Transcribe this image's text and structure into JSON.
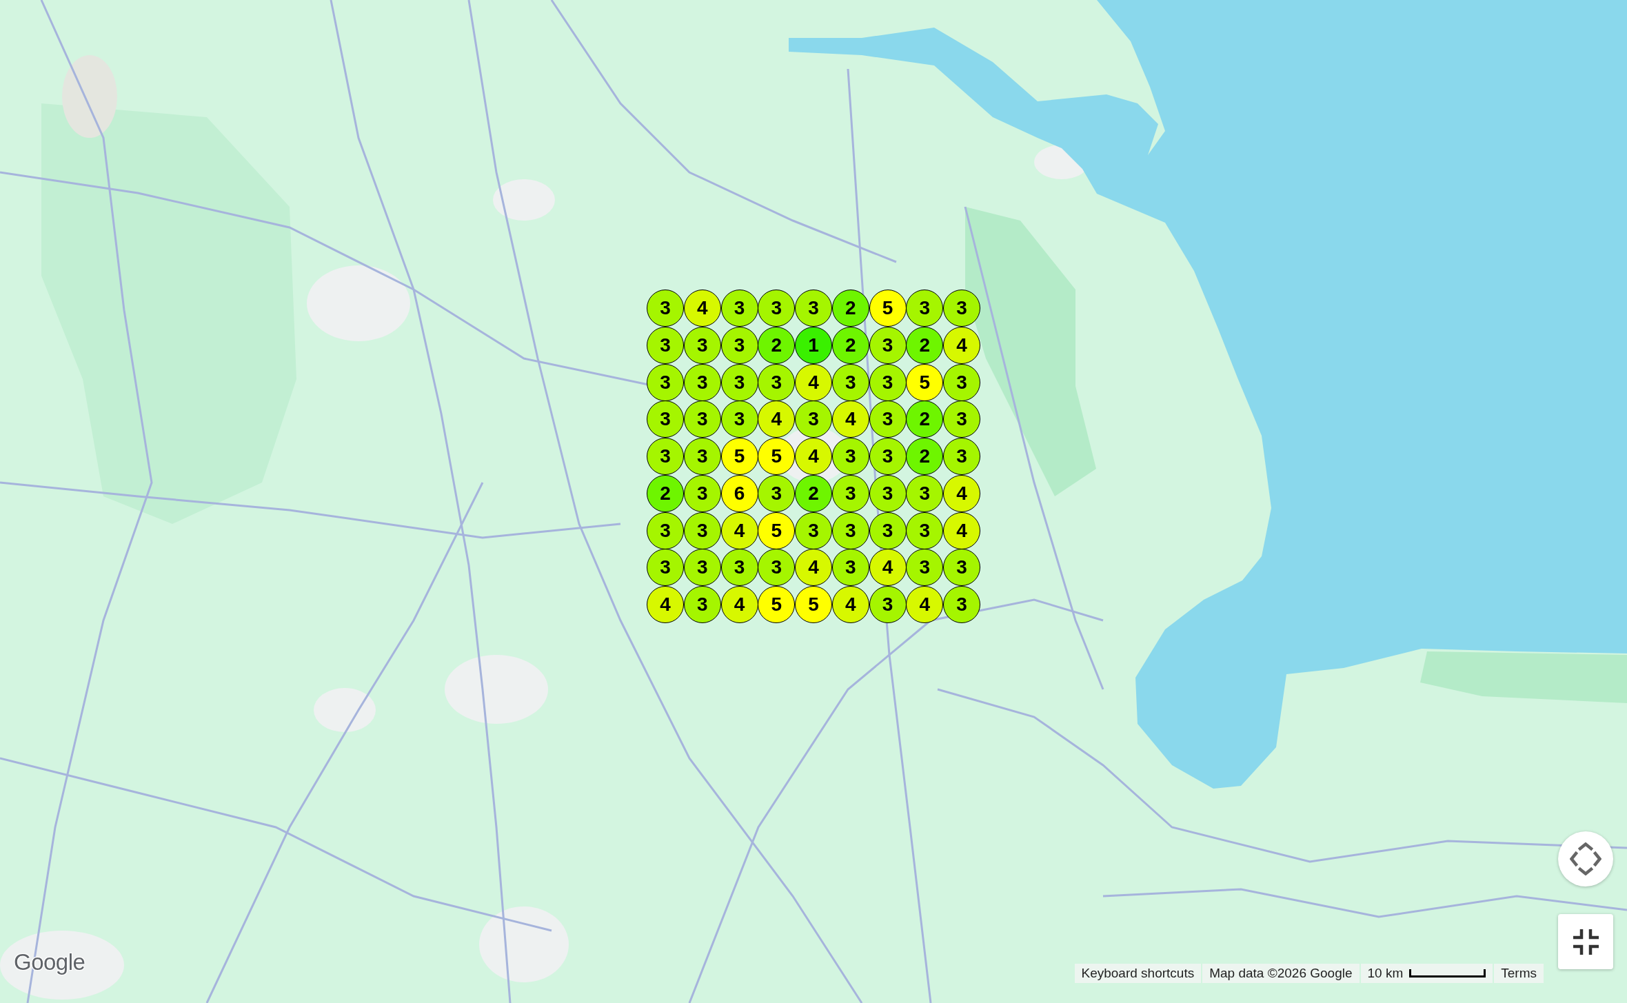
{
  "map": {
    "grid": {
      "rows": [
        [
          {
            "value": "3",
            "color": "#a5f500"
          },
          {
            "value": "4",
            "color": "#d7f800"
          },
          {
            "value": "3",
            "color": "#a5f500"
          },
          {
            "value": "3",
            "color": "#a5f500"
          },
          {
            "value": "3",
            "color": "#a5f500"
          },
          {
            "value": "2",
            "color": "#6ef500"
          },
          {
            "value": "5",
            "color": "#ffff00"
          },
          {
            "value": "3",
            "color": "#a5f500"
          },
          {
            "value": "3",
            "color": "#a5f500"
          }
        ],
        [
          {
            "value": "3",
            "color": "#a5f500"
          },
          {
            "value": "3",
            "color": "#a5f500"
          },
          {
            "value": "3",
            "color": "#a5f500"
          },
          {
            "value": "2",
            "color": "#6ef500"
          },
          {
            "value": "1",
            "color": "#3af000"
          },
          {
            "value": "2",
            "color": "#6ef500"
          },
          {
            "value": "3",
            "color": "#a5f500"
          },
          {
            "value": "2",
            "color": "#6ef500"
          },
          {
            "value": "4",
            "color": "#d7f800"
          }
        ],
        [
          {
            "value": "3",
            "color": "#a5f500"
          },
          {
            "value": "3",
            "color": "#a5f500"
          },
          {
            "value": "3",
            "color": "#a5f500"
          },
          {
            "value": "3",
            "color": "#a5f500"
          },
          {
            "value": "4",
            "color": "#d7f800"
          },
          {
            "value": "3",
            "color": "#a5f500"
          },
          {
            "value": "3",
            "color": "#a5f500"
          },
          {
            "value": "5",
            "color": "#ffff00"
          },
          {
            "value": "3",
            "color": "#a5f500"
          }
        ],
        [
          {
            "value": "3",
            "color": "#a5f500"
          },
          {
            "value": "3",
            "color": "#a5f500"
          },
          {
            "value": "3",
            "color": "#a5f500"
          },
          {
            "value": "4",
            "color": "#d7f800"
          },
          {
            "value": "3",
            "color": "#a5f500"
          },
          {
            "value": "4",
            "color": "#d7f800"
          },
          {
            "value": "3",
            "color": "#a5f500"
          },
          {
            "value": "2",
            "color": "#6ef500"
          },
          {
            "value": "3",
            "color": "#a5f500"
          }
        ],
        [
          {
            "value": "3",
            "color": "#a5f500"
          },
          {
            "value": "3",
            "color": "#a5f500"
          },
          {
            "value": "5",
            "color": "#ffff00"
          },
          {
            "value": "5",
            "color": "#ffff00"
          },
          {
            "value": "4",
            "color": "#d7f800"
          },
          {
            "value": "3",
            "color": "#a5f500"
          },
          {
            "value": "3",
            "color": "#a5f500"
          },
          {
            "value": "2",
            "color": "#6ef500"
          },
          {
            "value": "3",
            "color": "#a5f500"
          }
        ],
        [
          {
            "value": "2",
            "color": "#6ef500"
          },
          {
            "value": "3",
            "color": "#a5f500"
          },
          {
            "value": "6",
            "color": "#ffff00"
          },
          {
            "value": "3",
            "color": "#a5f500"
          },
          {
            "value": "2",
            "color": "#6ef500"
          },
          {
            "value": "3",
            "color": "#a5f500"
          },
          {
            "value": "3",
            "color": "#a5f500"
          },
          {
            "value": "3",
            "color": "#a5f500"
          },
          {
            "value": "4",
            "color": "#d7f800"
          }
        ],
        [
          {
            "value": "3",
            "color": "#a5f500"
          },
          {
            "value": "3",
            "color": "#a5f500"
          },
          {
            "value": "4",
            "color": "#d7f800"
          },
          {
            "value": "5",
            "color": "#ffff00"
          },
          {
            "value": "3",
            "color": "#a5f500"
          },
          {
            "value": "3",
            "color": "#a5f500"
          },
          {
            "value": "3",
            "color": "#a5f500"
          },
          {
            "value": "3",
            "color": "#a5f500"
          },
          {
            "value": "4",
            "color": "#d7f800"
          }
        ],
        [
          {
            "value": "3",
            "color": "#a5f500"
          },
          {
            "value": "3",
            "color": "#a5f500"
          },
          {
            "value": "3",
            "color": "#a5f500"
          },
          {
            "value": "3",
            "color": "#a5f500"
          },
          {
            "value": "4",
            "color": "#d7f800"
          },
          {
            "value": "3",
            "color": "#a5f500"
          },
          {
            "value": "4",
            "color": "#d7f800"
          },
          {
            "value": "3",
            "color": "#a5f500"
          },
          {
            "value": "3",
            "color": "#a5f500"
          }
        ],
        [
          {
            "value": "4",
            "color": "#d7f800"
          },
          {
            "value": "3",
            "color": "#a5f500"
          },
          {
            "value": "4",
            "color": "#d7f800"
          },
          {
            "value": "5",
            "color": "#ffff00"
          },
          {
            "value": "5",
            "color": "#ffff00"
          },
          {
            "value": "4",
            "color": "#d7f800"
          },
          {
            "value": "3",
            "color": "#a5f500"
          },
          {
            "value": "4",
            "color": "#d7f800"
          },
          {
            "value": "3",
            "color": "#a5f500"
          }
        ]
      ]
    }
  },
  "logo": "Google",
  "attribution": {
    "keyboard_shortcuts": "Keyboard shortcuts",
    "map_data": "Map data ©2026 Google",
    "scale": "10 km",
    "terms": "Terms"
  }
}
